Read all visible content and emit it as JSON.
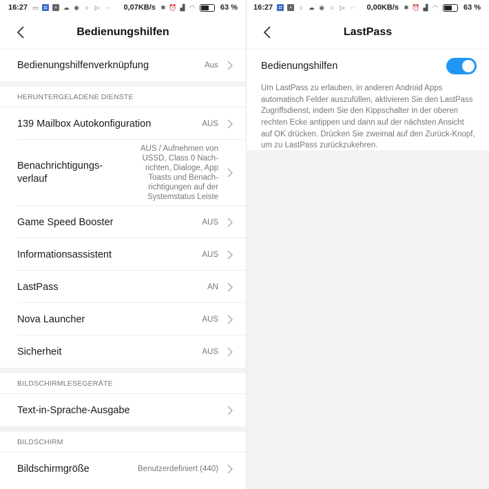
{
  "left": {
    "status": {
      "time": "16:27",
      "dots": "··",
      "netspeed": "0,07KB/s",
      "battery": "63 %"
    },
    "title": "Bedienungshilfen",
    "shortcut": {
      "label": "Bedienungshilfenverknüpfung",
      "value": "Aus"
    },
    "downloaded": {
      "header": "HERUNTERGELADENE DIENSTE",
      "items": [
        {
          "label": "139 Mailbox Autokonfiguration",
          "value": "AUS"
        },
        {
          "label": "Benachrichtigungs-\nverlauf",
          "value": "AUS / Aufnehmen von USSD, Class 0 Nach-\nrichten, Dialoge, App Toasts und Benach-\nrichtigungen auf der Systemstatus Leiste"
        },
        {
          "label": "Game Speed Booster",
          "value": "AUS"
        },
        {
          "label": "Informationsassistent",
          "value": "AUS"
        },
        {
          "label": "LastPass",
          "value": "AN"
        },
        {
          "label": "Nova Launcher",
          "value": "AUS"
        },
        {
          "label": "Sicherheit",
          "value": "AUS"
        }
      ]
    },
    "screenreaders": {
      "header": "BILDSCHIRMLESEGERÄTE",
      "items": [
        {
          "label": "Text-in-Sprache-Ausgabe",
          "value": ""
        }
      ]
    },
    "display": {
      "header": "BILDSCHIRM",
      "items": [
        {
          "label": "Bildschirmgröße",
          "value": "Benutzerdefiniert (440)"
        }
      ]
    }
  },
  "right": {
    "status": {
      "time": "16:27",
      "dots": "··",
      "netspeed": "0,00KB/s",
      "battery": "63 %"
    },
    "title": "LastPass",
    "toggle": {
      "label": "Bedienungshilfen",
      "on": true
    },
    "description": "Um LastPass zu erlauben, in anderen Android Apps automatisch Felder auszufüllen, aktivieren Sie den LastPass Zugriffsdienst, indem Sie den Kippschalter in der oberen rechten Ecke antippen und dann auf der nächsten Ansicht auf OK drücken. Drücken Sie zweimal auf den Zurück-Knopf, um zu LastPass zurückzukehren."
  },
  "colors": {
    "accent": "#2196f3",
    "separator": "#f2f2f2",
    "secondary_text": "#777777"
  }
}
